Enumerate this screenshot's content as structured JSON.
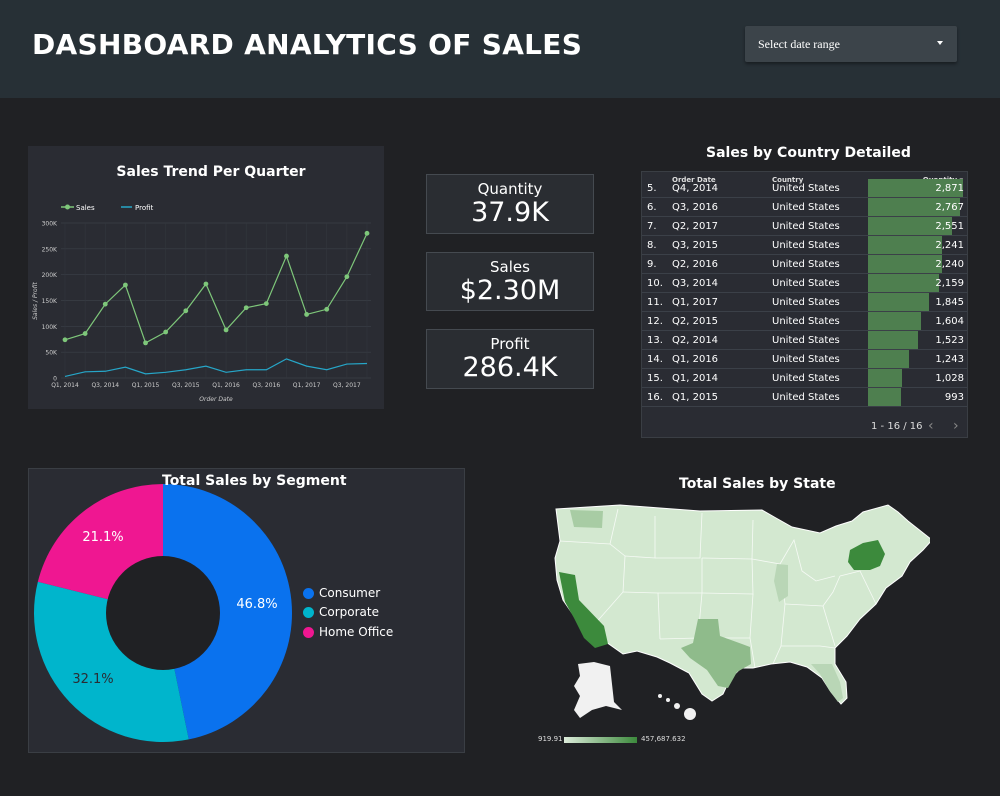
{
  "header": {
    "title": "DASHBOARD ANALYTICS OF SALES",
    "date_range_label": "Select date range"
  },
  "colors": {
    "sales_line": "#7ec77a",
    "profit_line": "#26a6c8",
    "consumer": "#0a72ee",
    "corporate": "#00b5cc",
    "home_office": "#ef1791",
    "map_high": "#3c8a3c",
    "map_low": "#dcebda"
  },
  "trend_chart": {
    "title": "Sales Trend Per Quarter",
    "legend": [
      "Sales",
      "Profit"
    ],
    "xlabel": "Order Date",
    "ylabel": "Sales / Profit",
    "y_ticks": [
      "300K",
      "250K",
      "200K",
      "150K",
      "100K",
      "50K",
      "0"
    ],
    "x_ticks": [
      "Q1, 2014",
      "Q3, 2014",
      "Q1, 2015",
      "Q3, 2015",
      "Q1, 2016",
      "Q3, 2016",
      "Q1, 2017",
      "Q3, 2017"
    ]
  },
  "kpis": [
    {
      "label": "Quantity",
      "value": "37.9K"
    },
    {
      "label": "Sales",
      "value": "$2.30M"
    },
    {
      "label": "Profit",
      "value": "286.4K"
    }
  ],
  "table": {
    "title": "Sales by Country Detailed",
    "headers": [
      "Order Date",
      "Country",
      "Quantity"
    ],
    "sort_indicator": "▾",
    "rows": [
      {
        "n": "5.",
        "date": "Q4, 2014",
        "country": "United States",
        "qty": "2,871",
        "val": 2871
      },
      {
        "n": "6.",
        "date": "Q3, 2016",
        "country": "United States",
        "qty": "2,767",
        "val": 2767
      },
      {
        "n": "7.",
        "date": "Q2, 2017",
        "country": "United States",
        "qty": "2,551",
        "val": 2551
      },
      {
        "n": "8.",
        "date": "Q3, 2015",
        "country": "United States",
        "qty": "2,241",
        "val": 2241
      },
      {
        "n": "9.",
        "date": "Q2, 2016",
        "country": "United States",
        "qty": "2,240",
        "val": 2240
      },
      {
        "n": "10.",
        "date": "Q3, 2014",
        "country": "United States",
        "qty": "2,159",
        "val": 2159
      },
      {
        "n": "11.",
        "date": "Q1, 2017",
        "country": "United States",
        "qty": "1,845",
        "val": 1845
      },
      {
        "n": "12.",
        "date": "Q2, 2015",
        "country": "United States",
        "qty": "1,604",
        "val": 1604
      },
      {
        "n": "13.",
        "date": "Q2, 2014",
        "country": "United States",
        "qty": "1,523",
        "val": 1523
      },
      {
        "n": "14.",
        "date": "Q1, 2016",
        "country": "United States",
        "qty": "1,243",
        "val": 1243
      },
      {
        "n": "15.",
        "date": "Q1, 2014",
        "country": "United States",
        "qty": "1,028",
        "val": 1028
      },
      {
        "n": "16.",
        "date": "Q1, 2015",
        "country": "United States",
        "qty": "993",
        "val": 993
      }
    ],
    "pagination": "1 - 16 / 16"
  },
  "segment_chart": {
    "title": "Total Sales by Segment",
    "labels": [
      "21.1%",
      "46.8%",
      "32.1%"
    ]
  },
  "map": {
    "title": "Total Sales by State",
    "min_label": "919.91",
    "max_label": "457,687.632"
  },
  "chart_data": [
    {
      "type": "line",
      "title": "Sales Trend Per Quarter",
      "xlabel": "Order Date",
      "ylabel": "Sales / Profit",
      "categories": [
        "Q1, 2014",
        "Q2, 2014",
        "Q3, 2014",
        "Q4, 2014",
        "Q1, 2015",
        "Q2, 2015",
        "Q3, 2015",
        "Q4, 2015",
        "Q1, 2016",
        "Q2, 2016",
        "Q3, 2016",
        "Q4, 2016",
        "Q1, 2017",
        "Q2, 2017",
        "Q3, 2017",
        "Q4, 2017"
      ],
      "ylim": [
        0,
        300000
      ],
      "series": [
        {
          "name": "Sales",
          "values": [
            74000,
            86000,
            143000,
            180000,
            68000,
            89000,
            130000,
            182000,
            93000,
            136000,
            144000,
            236000,
            123000,
            133000,
            196000,
            280000
          ]
        },
        {
          "name": "Profit",
          "values": [
            3000,
            12000,
            13000,
            21000,
            8000,
            11000,
            16000,
            23000,
            11000,
            16000,
            16000,
            37000,
            23000,
            16000,
            27000,
            28000
          ]
        }
      ]
    },
    {
      "type": "pie",
      "title": "Total Sales by Segment",
      "categories": [
        "Consumer",
        "Corporate",
        "Home Office"
      ],
      "values": [
        46.8,
        32.1,
        21.1
      ]
    }
  ]
}
